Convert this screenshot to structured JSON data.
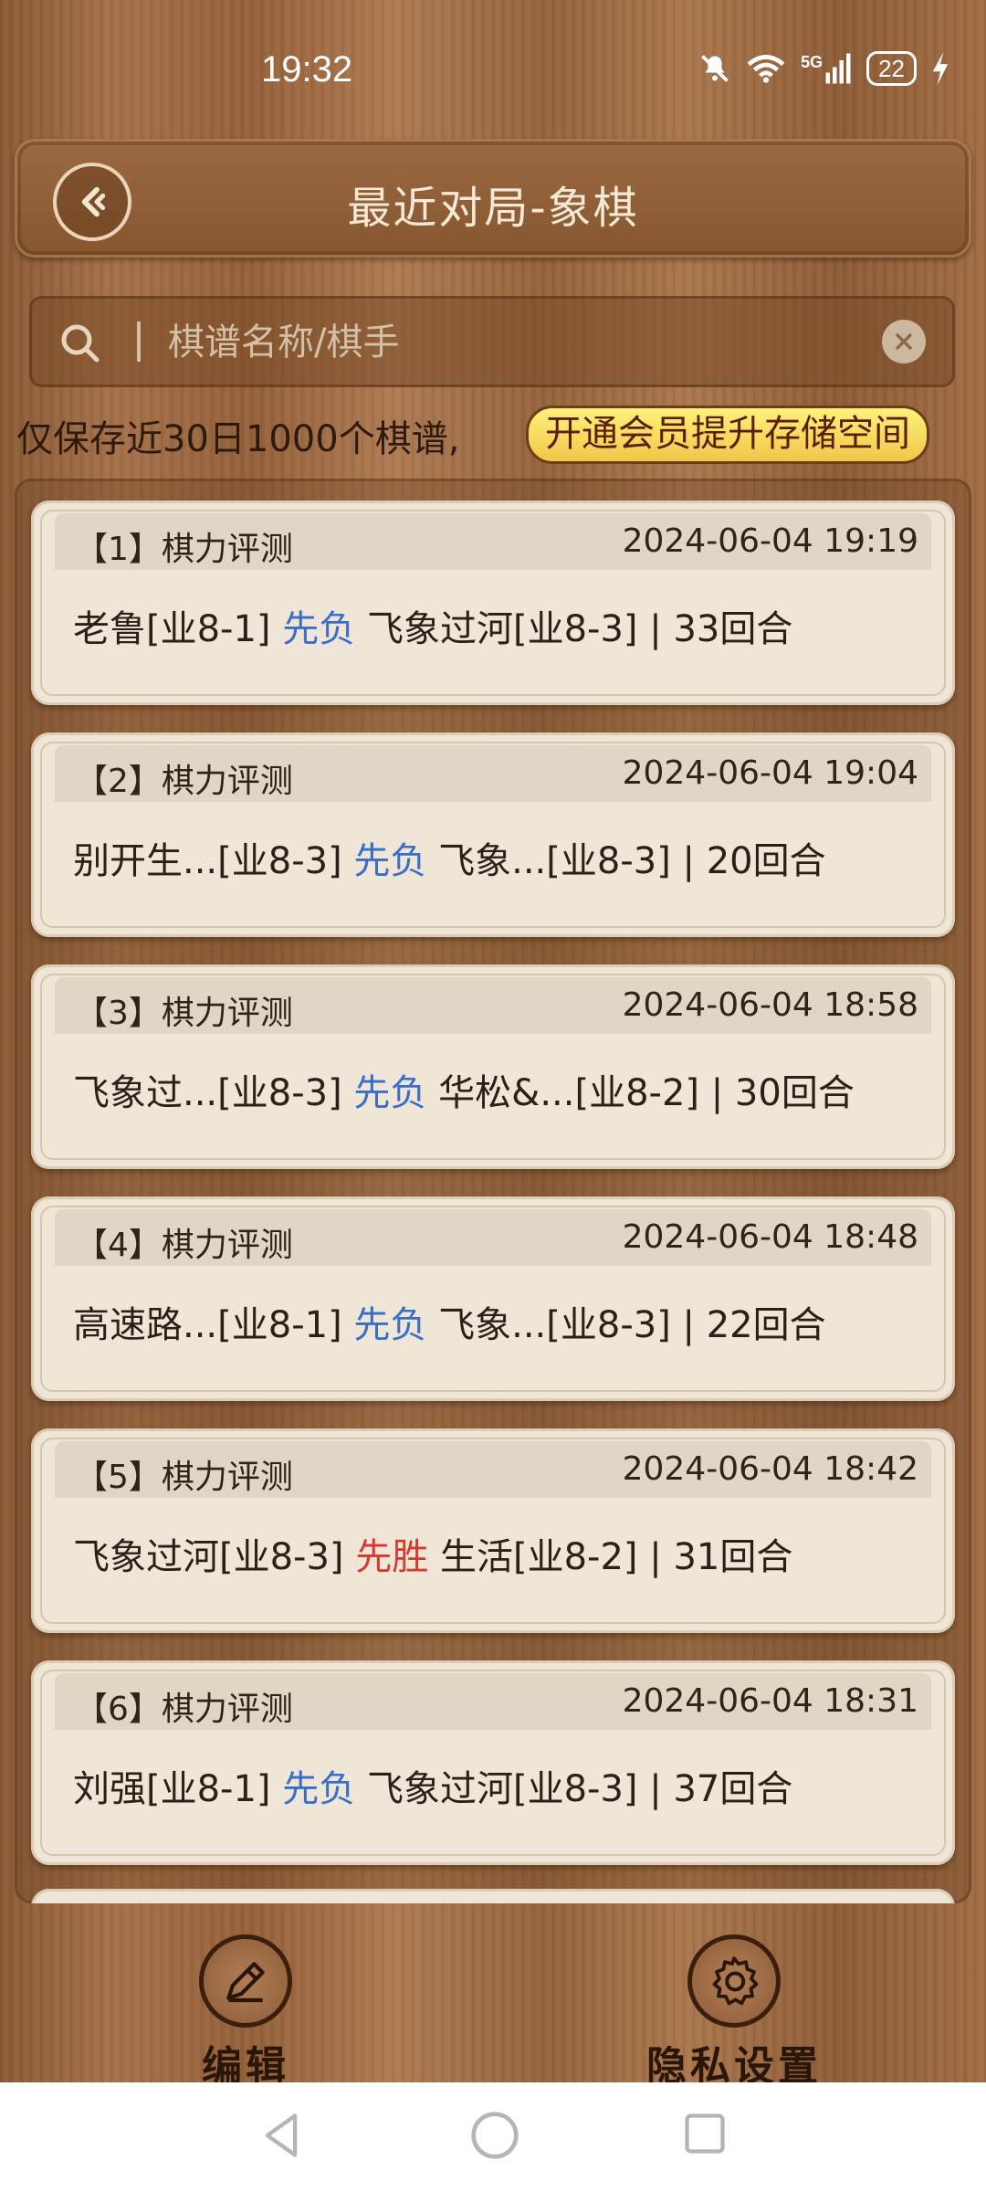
{
  "status_bar": {
    "time": "19:32",
    "network_label": "5G",
    "battery": "22",
    "icons": [
      "mute-bell-icon",
      "wifi-icon",
      "signal-icon",
      "battery-icon",
      "charging-icon"
    ]
  },
  "header": {
    "title": "最近对局-象棋",
    "back_icon": "back-arrow-icon"
  },
  "search": {
    "placeholder": "棋谱名称/棋手",
    "value": ""
  },
  "notice": {
    "text": "仅保存近30日1000个棋谱,",
    "vip_button": "开通会员提升存储空间"
  },
  "games": [
    {
      "index": "【1】",
      "mode": "棋力评测",
      "time": "2024-06-04 19:19",
      "player1": "老鲁[业8-1]",
      "result": "先负",
      "result_type": "lose",
      "player2": "飞象过河[业8-3]",
      "moves": "| 33回合"
    },
    {
      "index": "【2】",
      "mode": "棋力评测",
      "time": "2024-06-04 19:04",
      "player1": "别开生...[业8-3]",
      "result": "先负",
      "result_type": "lose",
      "player2": "飞象...[业8-3]",
      "moves": "| 20回合"
    },
    {
      "index": "【3】",
      "mode": "棋力评测",
      "time": "2024-06-04 18:58",
      "player1": "飞象过...[业8-3]",
      "result": "先负",
      "result_type": "lose",
      "player2": "华松&...[业8-2]",
      "moves": "| 30回合"
    },
    {
      "index": "【4】",
      "mode": "棋力评测",
      "time": "2024-06-04 18:48",
      "player1": "高速路...[业8-1]",
      "result": "先负",
      "result_type": "lose",
      "player2": "飞象...[业8-3]",
      "moves": "| 22回合"
    },
    {
      "index": "【5】",
      "mode": "棋力评测",
      "time": "2024-06-04 18:42",
      "player1": "飞象过河[业8-3]",
      "result": "先胜",
      "result_type": "win",
      "player2": "生活[业8-2]",
      "moves": "| 31回合"
    },
    {
      "index": "【6】",
      "mode": "棋力评测",
      "time": "2024-06-04 18:31",
      "player1": "刘强[业8-1]",
      "result": "先负",
      "result_type": "lose",
      "player2": "飞象过河[业8-3]",
      "moves": "| 37回合"
    }
  ],
  "bottom_tools": {
    "edit_label": "编辑",
    "privacy_label": "隐私设置"
  },
  "colors": {
    "lose": "#3a6fc9",
    "win": "#d63a2e",
    "card_bg": "#efe6d8",
    "vip_yellow": "#f8dc5a"
  }
}
